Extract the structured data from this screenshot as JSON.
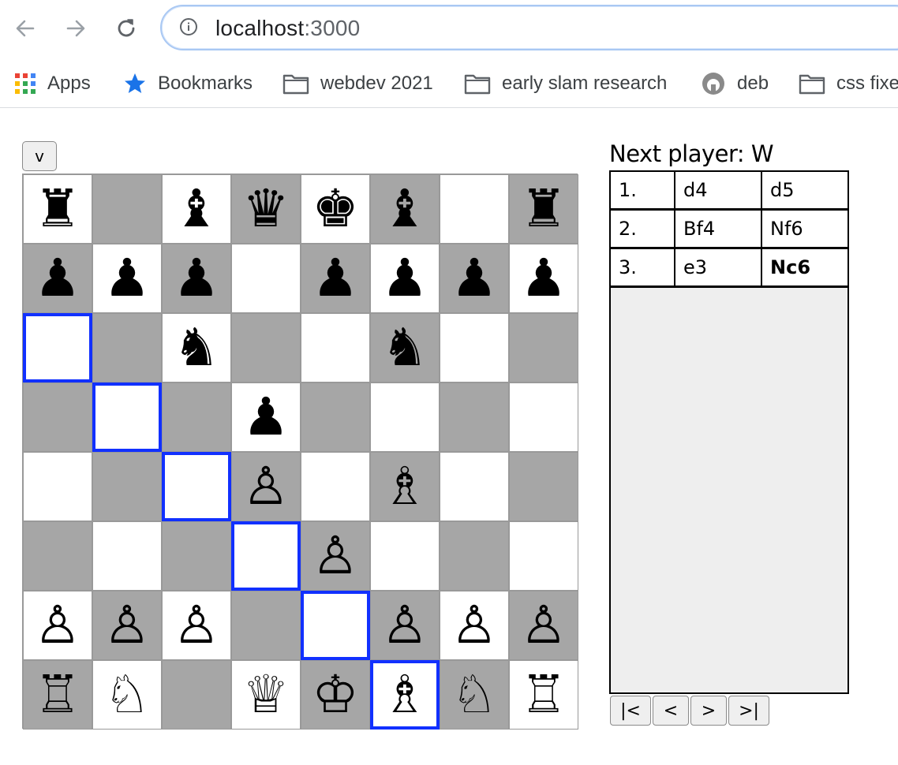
{
  "browser": {
    "url_host": "localhost",
    "url_port": ":3000",
    "bookmarks": [
      {
        "label": "Apps",
        "icon": "apps-grid-icon"
      },
      {
        "label": "Bookmarks",
        "icon": "star-icon"
      },
      {
        "label": "webdev 2021",
        "icon": "folder-icon"
      },
      {
        "label": "early slam research",
        "icon": "folder-icon"
      },
      {
        "label": "deb",
        "icon": "site-favicon-icon"
      },
      {
        "label": "css fixe",
        "icon": "folder-icon"
      }
    ]
  },
  "game": {
    "flip_button": "v",
    "status": "Next player: W",
    "board": [
      [
        "♜",
        "",
        "♝",
        "♛",
        "♚",
        "♝",
        "",
        "♜"
      ],
      [
        "♟",
        "♟",
        "♟",
        "",
        "♟",
        "♟",
        "♟",
        "♟"
      ],
      [
        "",
        "",
        "♞",
        "",
        "",
        "♞",
        "",
        ""
      ],
      [
        "",
        "",
        "",
        "♟",
        "",
        "",
        "",
        ""
      ],
      [
        "",
        "",
        "",
        "♙",
        "",
        "♗",
        "",
        ""
      ],
      [
        "",
        "",
        "",
        "",
        "♙",
        "",
        "",
        ""
      ],
      [
        "♙",
        "♙",
        "♙",
        "",
        "",
        "♙",
        "♙",
        "♙"
      ],
      [
        "♖",
        "♘",
        "",
        "♕",
        "♔",
        "♗",
        "♘",
        "♖"
      ]
    ],
    "highlighted_squares": [
      "a6",
      "b5",
      "c4",
      "d3",
      "e2",
      "f1"
    ],
    "moves": [
      {
        "num": "1.",
        "white": "d4",
        "black": "d5"
      },
      {
        "num": "2.",
        "white": "Bf4",
        "black": "Nf6"
      },
      {
        "num": "3.",
        "white": "e3",
        "black": "Nc6"
      }
    ],
    "current_move": "Nc6",
    "nav_buttons": [
      "|<",
      "<",
      ">",
      ">|"
    ]
  },
  "colors": {
    "light_square": "#ffffff",
    "dark_square": "#a6a6a6",
    "highlight": "#1130ff",
    "history_bg": "#eeeeee"
  }
}
